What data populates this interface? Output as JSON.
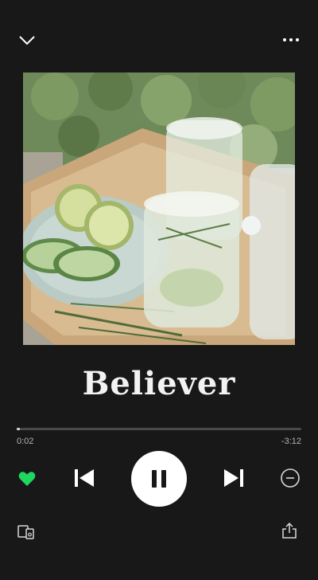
{
  "track": {
    "title": "Believer"
  },
  "playback": {
    "elapsed": "0:02",
    "remaining": "-3:12",
    "progress_fraction": 0.01,
    "is_playing": true,
    "liked": true
  },
  "icons": {
    "collapse": "chevron-down-icon",
    "more": "more-dots-icon",
    "like": "heart-icon",
    "previous": "skip-previous-icon",
    "pause": "pause-icon",
    "next": "skip-next-icon",
    "hide": "minus-circle-icon",
    "devices": "devices-icon",
    "share": "share-icon"
  },
  "colors": {
    "background": "#181818",
    "accent_green": "#1ed760",
    "text": "#ffffff",
    "muted": "#b3b3b3"
  }
}
